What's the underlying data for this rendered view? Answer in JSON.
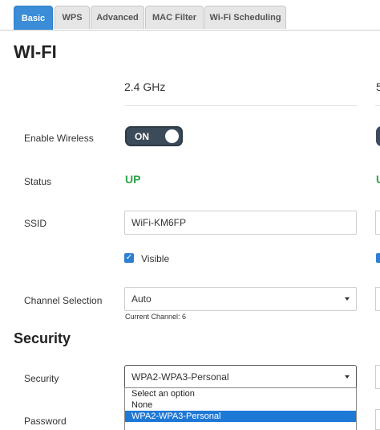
{
  "tabs": [
    "Basic",
    "WPS",
    "Advanced",
    "MAC Filter",
    "Wi-Fi Scheduling"
  ],
  "active_tab": "Basic",
  "section_title": "WI-FI",
  "band": {
    "primary": "2.4 GHz",
    "secondary": "5"
  },
  "fields": {
    "enable_wireless_label": "Enable Wireless",
    "toggle_text": "ON",
    "status_label": "Status",
    "status_value": "UP",
    "status_value_secondary": "U",
    "ssid_label": "SSID",
    "ssid_value": "WiFi-KM6FP",
    "visible_label": "Visible",
    "channel_label": "Channel Selection",
    "channel_value": "Auto",
    "current_channel": "Current Channel: 6"
  },
  "security": {
    "title": "Security",
    "label": "Security",
    "value": "WPA2-WPA3-Personal",
    "options": [
      "Select an option",
      "None",
      "WPA2-WPA3-Personal"
    ],
    "selected_option": "WPA2-WPA3-Personal",
    "password_label": "Password"
  },
  "colors": {
    "tab_active": "#3a8dd6",
    "status_up": "#2ea34a",
    "toggle_bg": "#3c4b5a",
    "checkbox": "#2f7fd1"
  }
}
